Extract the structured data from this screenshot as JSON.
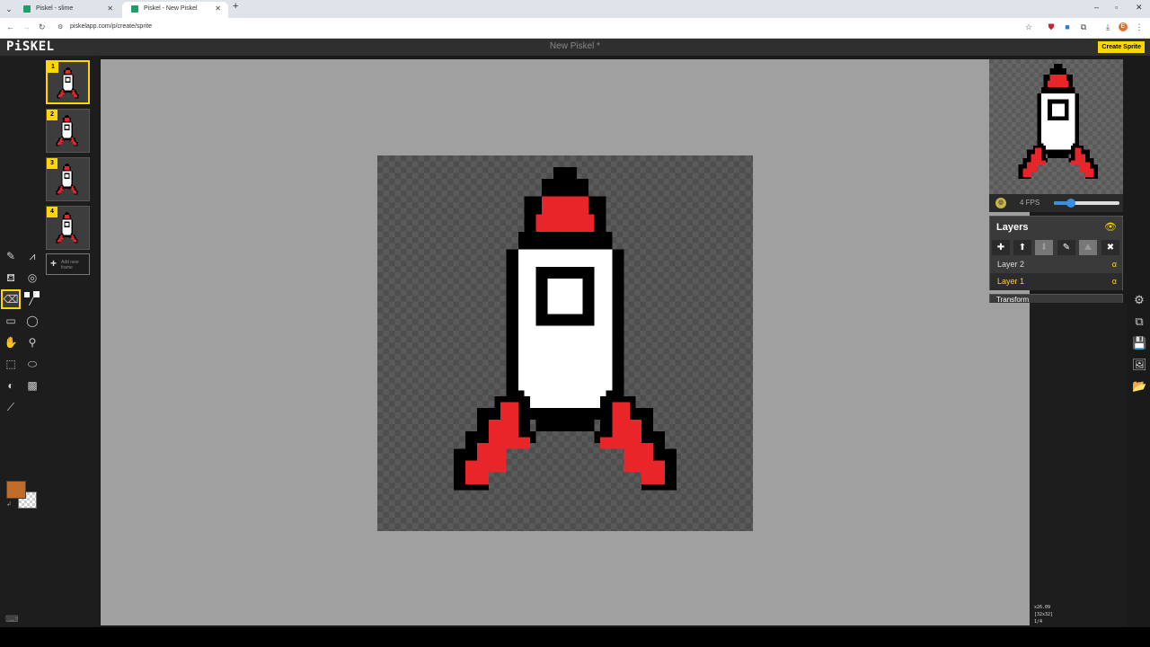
{
  "browser": {
    "tabs": [
      {
        "title": "Piskel - slime",
        "active": false
      },
      {
        "title": "Piskel - New Piskel",
        "active": true
      }
    ],
    "url": "piskelapp.com/p/create/sprite",
    "profile_initial": "E"
  },
  "app": {
    "logo": "PiSKEL",
    "title": "New Piskel *",
    "create_button": "Create Sprite"
  },
  "frames": {
    "items": [
      {
        "number": "1",
        "selected": true
      },
      {
        "number": "2",
        "selected": false
      },
      {
        "number": "3",
        "selected": false
      },
      {
        "number": "4",
        "selected": false
      }
    ],
    "add_label": "Add new frame"
  },
  "tools": {
    "selected": "eraser-tool",
    "primary_color": "#c06c28",
    "secondary_color": "transparent"
  },
  "preview": {
    "fps_label": "4 FPS",
    "fps_fraction": 0.25
  },
  "layers": {
    "title": "Layers",
    "items": [
      {
        "name": "Layer 2",
        "alpha": "α",
        "selected": false
      },
      {
        "name": "Layer 1",
        "alpha": "α",
        "selected": true
      }
    ]
  },
  "transform_title": "Transform",
  "status": {
    "zoom": "x26.09",
    "size": "[32x32]",
    "frame": "1/4"
  },
  "colors": {
    "accent": "#ffd700",
    "rocket_red": "#e8262a",
    "rocket_body": "#ffffff",
    "outline": "#000000"
  }
}
